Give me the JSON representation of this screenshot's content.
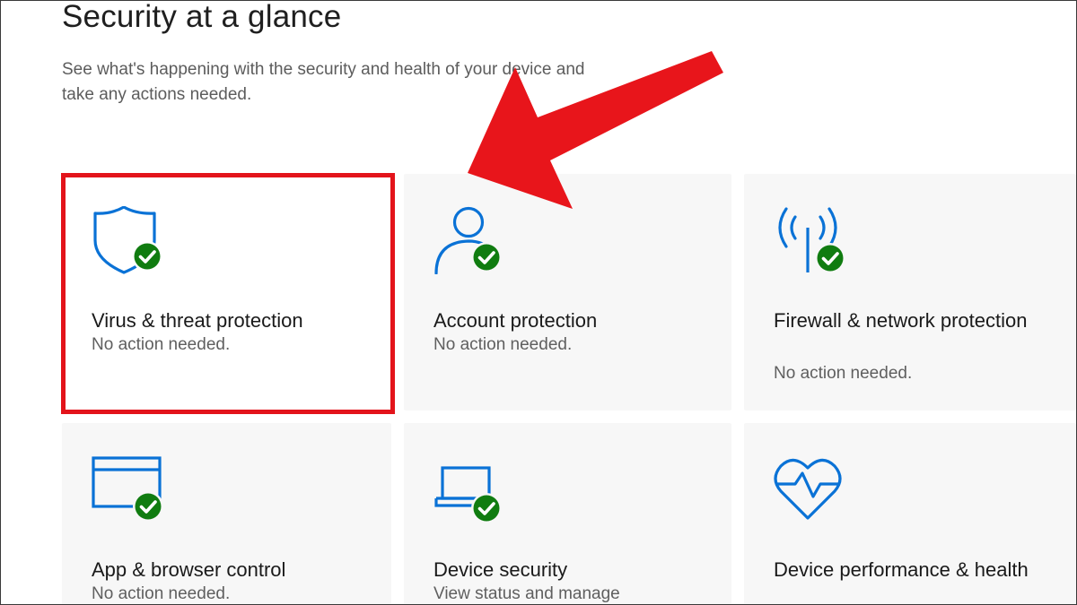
{
  "header": {
    "title": "Security at a glance",
    "subtitle": "See what's happening with the security and health of your device and take any actions needed."
  },
  "tiles": [
    {
      "icon": "shield-check-icon",
      "title": "Virus & threat protection",
      "status": "No action needed."
    },
    {
      "icon": "person-check-icon",
      "title": "Account protection",
      "status": "No action needed."
    },
    {
      "icon": "wireless-antenna-check-icon",
      "title": "Firewall & network protection",
      "status": "No action needed."
    },
    {
      "icon": "browser-window-check-icon",
      "title": "App & browser control",
      "status": "No action needed."
    },
    {
      "icon": "laptop-check-icon",
      "title": "Device security",
      "status": "View status and manage"
    },
    {
      "icon": "heart-pulse-icon",
      "title": "Device performance & health",
      "status": ""
    }
  ],
  "annotation": {
    "highlight": "red-rectangle",
    "pointer": "red-arrow",
    "highlight_target": "Virus & threat protection"
  },
  "colors": {
    "icon_blue": "#0a72d6",
    "check_green": "#107c10",
    "annotation_red": "#e3141b",
    "tile_bg": "#f7f7f7"
  }
}
